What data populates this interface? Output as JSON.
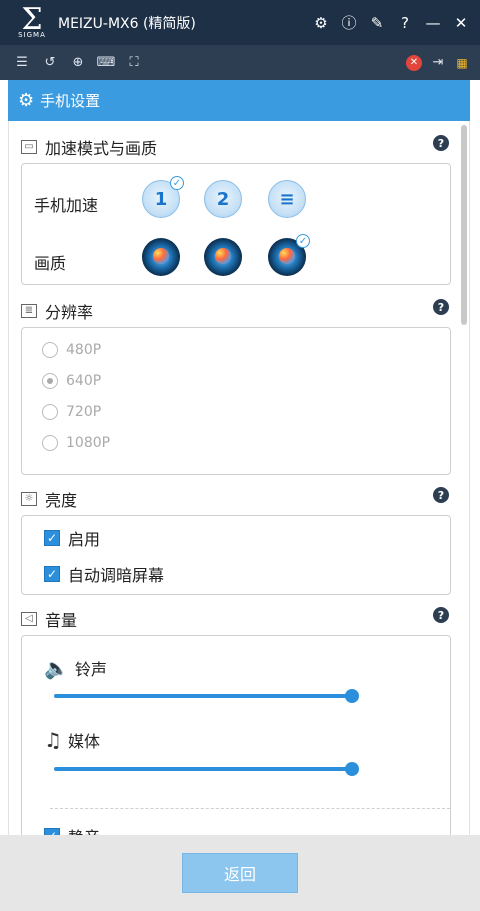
{
  "window": {
    "logo_text": "SIGMA",
    "title": "MEIZU-MX6 (精简版)"
  },
  "section": {
    "title": "手机设置"
  },
  "accel": {
    "title": "加速模式与画质",
    "phone_accel_label": "手机加速",
    "quality_label": "画质",
    "speed_icons": [
      "1",
      "2",
      "≡"
    ]
  },
  "resolution": {
    "title": "分辨率",
    "options": [
      "480P",
      "640P",
      "720P",
      "1080P"
    ],
    "selected": "640P"
  },
  "brightness": {
    "title": "亮度",
    "enable_label": "启用",
    "auto_dim_label": "自动调暗屏幕"
  },
  "volume": {
    "title": "音量",
    "ringtone_label": "铃声",
    "media_label": "媒体",
    "mute_label": "静音"
  },
  "footer": {
    "back_label": "返回"
  },
  "colors": {
    "accent": "#3b9be0",
    "title_bar": "#1e3046",
    "toolbar": "#2d3e53",
    "footer_bg": "#e6e6e6",
    "button": "#8cc6ef"
  }
}
